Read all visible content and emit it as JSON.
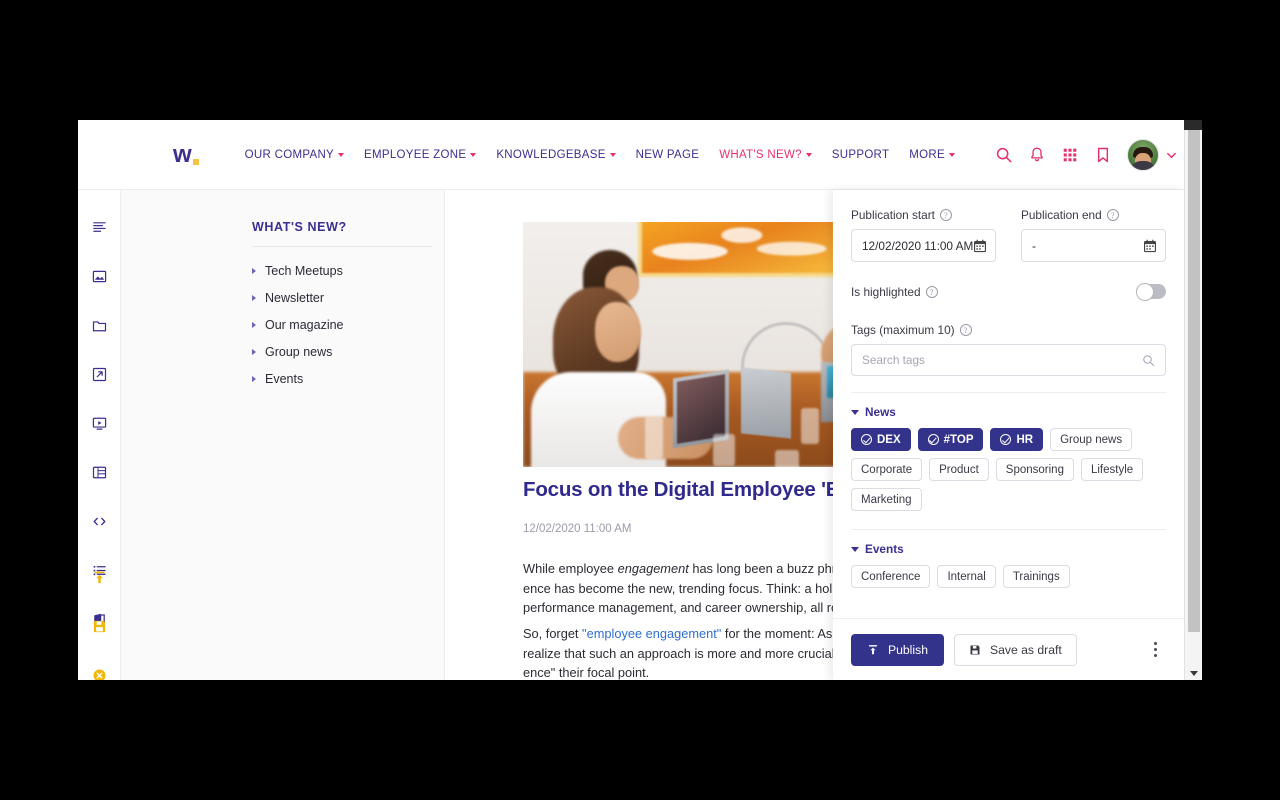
{
  "topnav": {
    "logo_text": "w",
    "items": [
      {
        "label": "OUR COMPANY",
        "caret": true,
        "active": false
      },
      {
        "label": "EMPLOYEE ZONE",
        "caret": true,
        "active": false
      },
      {
        "label": "KNOWLEDGEBASE",
        "caret": true,
        "active": false
      },
      {
        "label": "NEW PAGE",
        "caret": false,
        "active": false
      },
      {
        "label": "WHAT'S NEW?",
        "caret": true,
        "active": true
      },
      {
        "label": "SUPPORT",
        "caret": false,
        "active": false
      },
      {
        "label": "MORE",
        "caret": true,
        "active": false
      }
    ],
    "icons": [
      "search-icon",
      "bell-icon",
      "apps-grid-icon",
      "bookmark-icon"
    ],
    "accent_color": "#e6306e",
    "brand_color": "#3b2f8f"
  },
  "icon_rail": {
    "top_icons": [
      "text-block-icon",
      "image-icon",
      "folder-icon",
      "external-link-icon",
      "video-icon",
      "table-icon",
      "code-icon",
      "list-icon",
      "office-document-icon"
    ],
    "bottom_icons": [
      "publish-upload-icon",
      "save-icon",
      "cancel-icon",
      "settings-gear-icon"
    ],
    "bottom_accent": "#f2b705",
    "gear_color": "#2d3a8c"
  },
  "tree": {
    "title": "WHAT'S NEW?",
    "items": [
      {
        "label": "Tech Meetups"
      },
      {
        "label": "Newsletter"
      },
      {
        "label": "Our magazine"
      },
      {
        "label": "Group news"
      },
      {
        "label": "Events"
      }
    ]
  },
  "article": {
    "title": "Focus on the Digital Employee 'Experience'",
    "date": "12/02/2020 11:00 AM",
    "paragraph1_pre": "While employee ",
    "paragraph1_em1": "engagement",
    "paragraph1_mid": " has long been a buzz phrase for cor\nence",
    "paragraph1_post": " has become the new, trending focus. Think: a holistic approac\nperformance management, and career ownership, all rolled into on",
    "paragraph2_pre": "So, forget ",
    "paragraph2_link": "\"employee engagement\"",
    "paragraph2_post": " for the moment: As we move towa\nrealize that such an approach is more and more crucial for companies :\nence\" their focal point.",
    "hero_alt": "meeting-room-photo"
  },
  "panel": {
    "publication_start": {
      "label": "Publication start",
      "value": "12/02/2020 11:00 AM",
      "icon": "calendar-icon"
    },
    "publication_end": {
      "label": "Publication end",
      "value": "-",
      "icon": "calendar-icon"
    },
    "is_highlighted": {
      "label": "Is highlighted",
      "state": "off"
    },
    "tags": {
      "label": "Tags (maximum 10)",
      "placeholder": "Search tags",
      "value": ""
    },
    "groups": [
      {
        "name": "News",
        "expanded": true,
        "chips": [
          {
            "label": "DEX",
            "selected": true
          },
          {
            "label": "#TOP",
            "selected": true
          },
          {
            "label": "HR",
            "selected": true
          },
          {
            "label": "Group news",
            "selected": false
          },
          {
            "label": "Corporate",
            "selected": false
          },
          {
            "label": "Product",
            "selected": false
          },
          {
            "label": "Sponsoring",
            "selected": false
          },
          {
            "label": "Lifestyle",
            "selected": false
          },
          {
            "label": "Marketing",
            "selected": false
          }
        ]
      },
      {
        "name": "Events",
        "expanded": true,
        "chips": [
          {
            "label": "Conference",
            "selected": false
          },
          {
            "label": "Internal",
            "selected": false
          },
          {
            "label": "Trainings",
            "selected": false
          }
        ]
      }
    ],
    "footer": {
      "publish_label": "Publish",
      "draft_label": "Save as draft",
      "more_label": "More options",
      "publish_color": "#34338c"
    }
  }
}
